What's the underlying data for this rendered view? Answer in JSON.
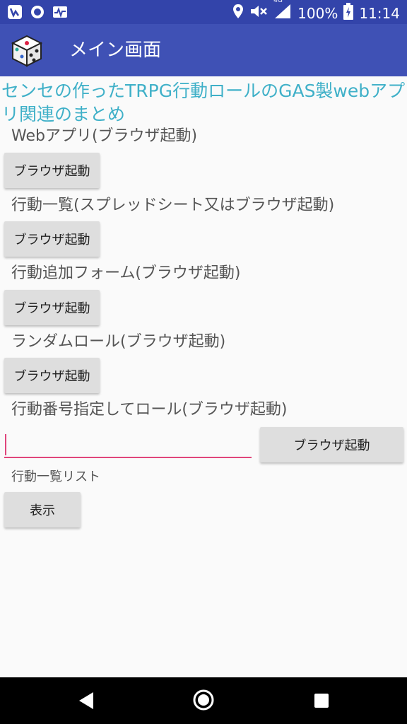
{
  "status_bar": {
    "battery": "100%",
    "time": "11:14",
    "network": "4G"
  },
  "app_bar": {
    "title": "メイン画面",
    "icon": "dice-icon"
  },
  "content": {
    "headline": "センセの作ったTRPG行動ロールのGAS製webアプリ関連のまとめ",
    "sections": [
      {
        "label": "Webアプリ(ブラウザ起動)",
        "button": "ブラウザ起動"
      },
      {
        "label": "行動一覧(スプレッドシート又はブラウザ起動)",
        "button": "ブラウザ起動"
      },
      {
        "label": "行動追加フォーム(ブラウザ起動)",
        "button": "ブラウザ起動"
      },
      {
        "label": "ランダムロール(ブラウザ起動)",
        "button": "ブラウザ起動"
      }
    ],
    "number_roll": {
      "label": "行動番号指定してロール(ブラウザ起動)",
      "input_value": "",
      "button": "ブラウザ起動"
    },
    "list": {
      "label": "行動一覧リスト",
      "button": "表示"
    }
  }
}
